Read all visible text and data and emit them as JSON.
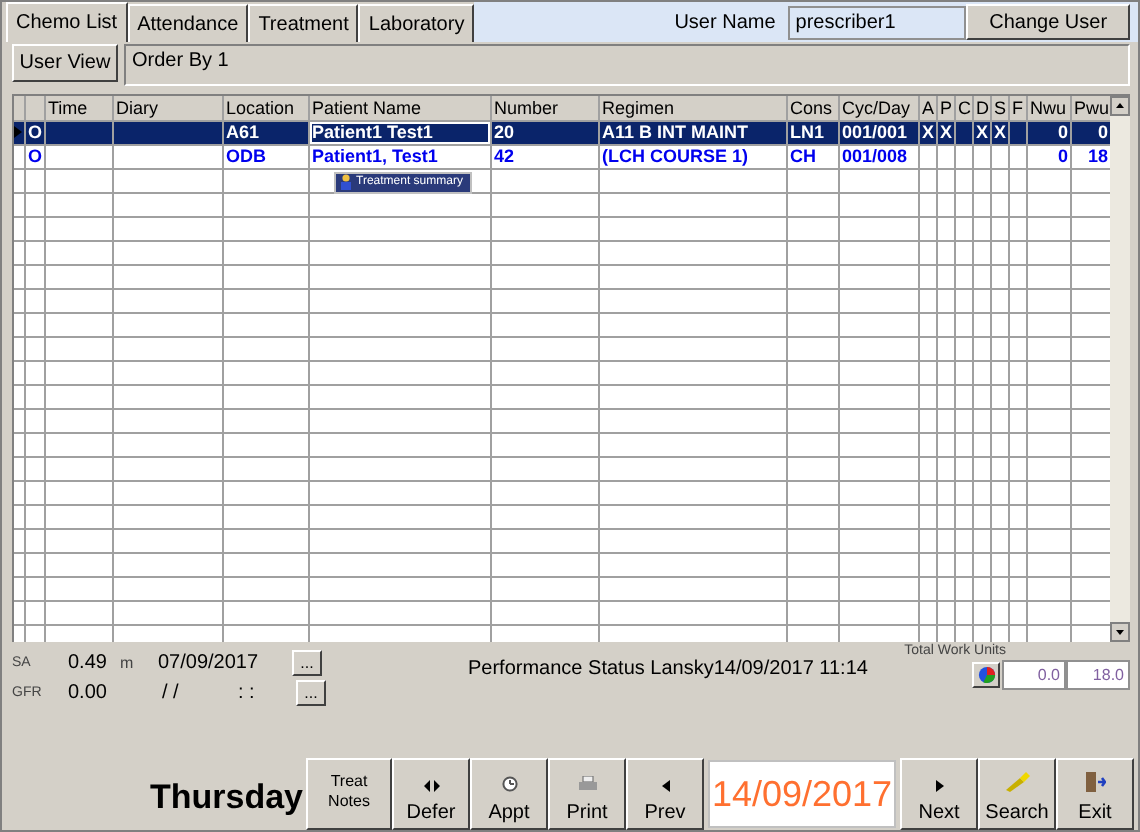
{
  "tabs": [
    {
      "label": "Chemo List",
      "selected": true
    },
    {
      "label": "Attendance",
      "selected": false
    },
    {
      "label": "Treatment",
      "selected": false
    },
    {
      "label": "Laboratory",
      "selected": false
    }
  ],
  "user_name": {
    "label": "User Name",
    "value": "prescriber1"
  },
  "change_user_button": "Change User",
  "user_view_button": "User View",
  "order_by": "Order By 1",
  "table": {
    "columns": [
      "Time",
      "Diary",
      "Location",
      "Patient Name",
      "Number",
      "Regimen",
      "Cons",
      "Cyc/Day",
      "A",
      "P",
      "C",
      "D",
      "S",
      "F",
      "Nwu",
      "Pwu"
    ],
    "rows": [
      {
        "selected": true,
        "status": "O",
        "cells": [
          null,
          null,
          "A61",
          "Patient1 Test1",
          "20",
          "A11 B INT MAINT",
          "LN1",
          "001/001",
          "X",
          "X",
          null,
          "X",
          "X",
          null,
          "0",
          "0"
        ]
      },
      {
        "selected": false,
        "status": "O",
        "cells": [
          null,
          null,
          "ODB",
          "Patient1, Test1",
          "42",
          "(LCH COURSE 1)",
          "CH",
          "001/008",
          null,
          null,
          null,
          null,
          null,
          null,
          "0",
          "18"
        ]
      }
    ]
  },
  "tooltip": "Treatment summary",
  "sa": {
    "label": "SA",
    "value": "0.49",
    "unit": "m",
    "date": "07/09/2017",
    "button": "..."
  },
  "gfr": {
    "label": "GFR",
    "value": "0.00",
    "date": "/ /",
    "time": ": :",
    "button": "..."
  },
  "performance_status": "Performance Status  Lansky14/09/2017 11:14",
  "total_work_units": {
    "label": "Total Work Units",
    "nwu": "0.0",
    "pwu": "18.0"
  },
  "day": "Thursday",
  "buttons_left": [
    {
      "label": "Treat Notes",
      "kind": "plain"
    },
    {
      "label": "Defer",
      "kind": "defer"
    },
    {
      "label": "Appt",
      "kind": "appt"
    },
    {
      "label": "Print",
      "kind": "print"
    },
    {
      "label": "Prev",
      "kind": "prev"
    }
  ],
  "date": "14/09/2017",
  "buttons_right": [
    {
      "label": "Next",
      "kind": "next"
    },
    {
      "label": "Search",
      "kind": "search"
    },
    {
      "label": "Exit",
      "kind": "exit"
    }
  ]
}
